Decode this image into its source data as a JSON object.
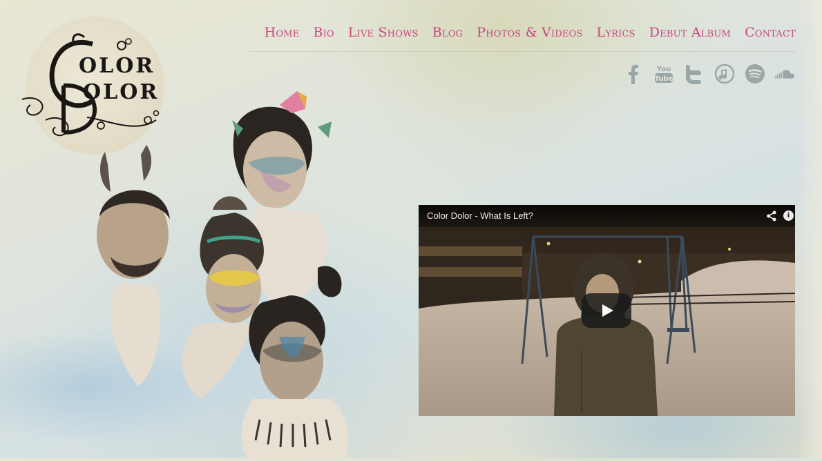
{
  "nav": {
    "items": [
      {
        "label": "Home"
      },
      {
        "label": "Bio"
      },
      {
        "label": "Live Shows"
      },
      {
        "label": "Blog"
      },
      {
        "label": "Photos & Videos"
      },
      {
        "label": "Lyrics"
      },
      {
        "label": "Debut Album"
      },
      {
        "label": "Contact"
      }
    ]
  },
  "logo": {
    "line1": "OLOR",
    "line2": "OLOR"
  },
  "social": {
    "icons": [
      "facebook-icon",
      "youtube-icon",
      "twitter-icon",
      "itunes-icon",
      "spotify-icon",
      "soundcloud-icon"
    ]
  },
  "video": {
    "title": "Color Dolor - What Is Left?",
    "info_label": "i"
  },
  "colors": {
    "nav": "#c8467f",
    "icons": "#9aa7a8",
    "logo": "#1a1614"
  }
}
